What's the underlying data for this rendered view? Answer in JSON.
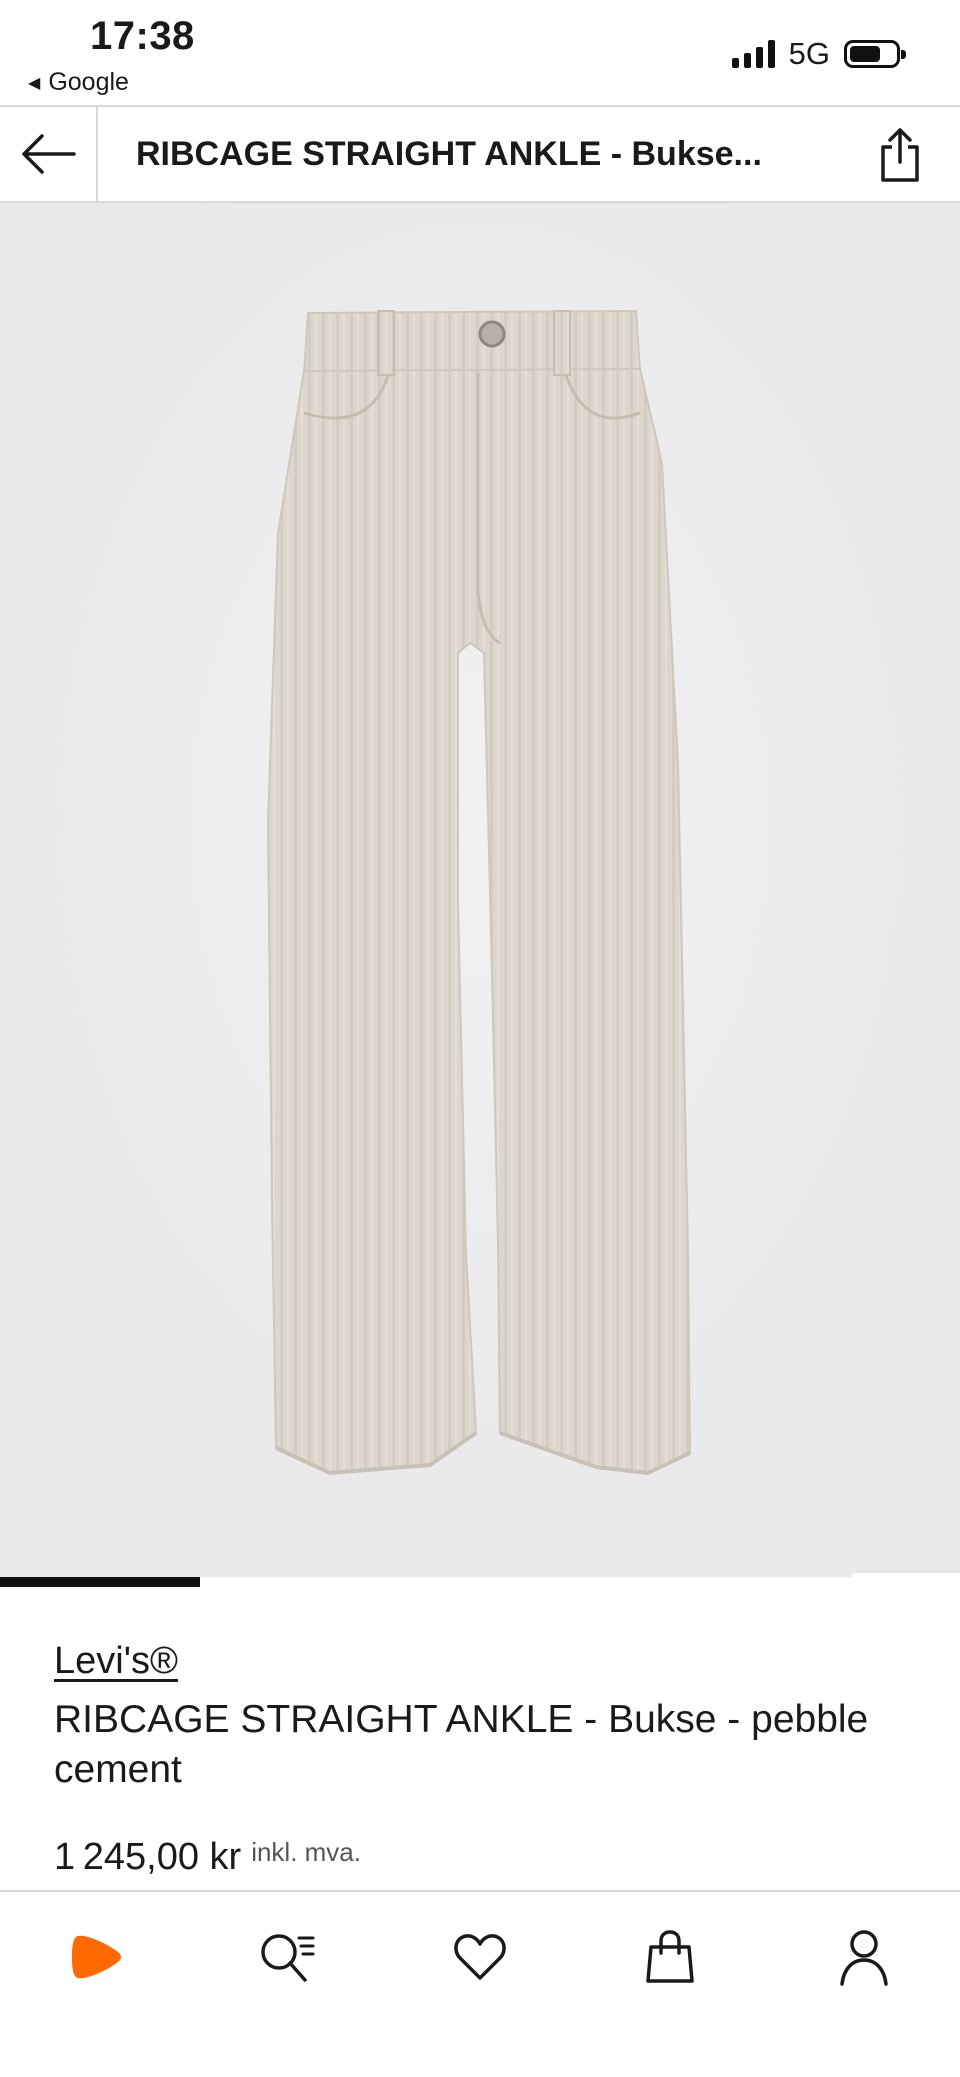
{
  "status_bar": {
    "time": "17:38",
    "back_app": "Google",
    "network": "5G"
  },
  "header": {
    "title": "RIBCAGE STRAIGHT ANKLE - Bukse..."
  },
  "product": {
    "brand": "Levi's®",
    "name": "RIBCAGE STRAIGHT ANKLE - Bukse - pebble cement",
    "price": "1 245,00 kr",
    "vat_note": "inkl. mva.",
    "image_progress": 0.25
  },
  "icons": {
    "back": "arrow-left-icon",
    "share": "share-icon",
    "try_on": "try-on-icon",
    "notify": "bell-icon",
    "wishlist": "heart-icon"
  },
  "bottom_nav": [
    {
      "name": "home",
      "icon": "zalando-logo-icon"
    },
    {
      "name": "search",
      "icon": "search-list-icon"
    },
    {
      "name": "wishlist",
      "icon": "heart-icon"
    },
    {
      "name": "bag",
      "icon": "shopping-bag-icon"
    },
    {
      "name": "account",
      "icon": "user-icon"
    }
  ],
  "colors": {
    "brand_orange": "#ff6900",
    "image_bg": "#ececee",
    "product": "#ddd6cc",
    "text": "#1a1a1a"
  }
}
